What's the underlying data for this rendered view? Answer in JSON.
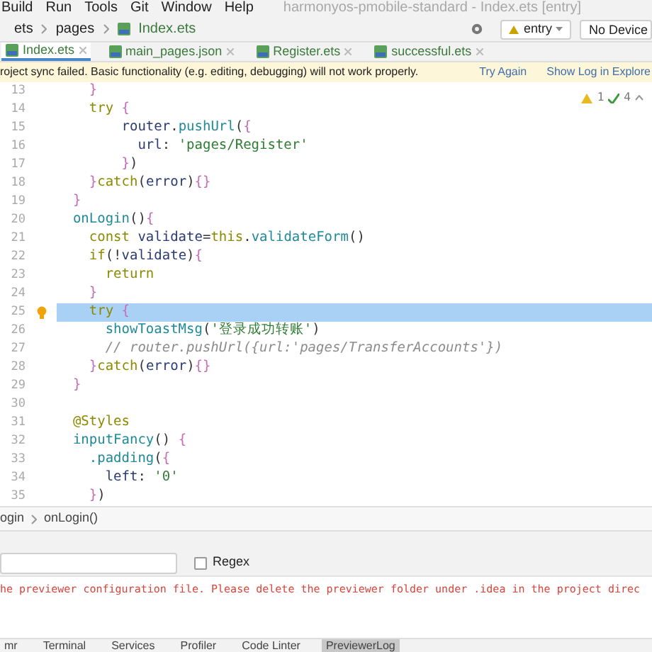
{
  "menu": [
    "Build",
    "Run",
    "Tools",
    "Git",
    "Window",
    "Help"
  ],
  "window_title": "harmonyos-pmobile-standard - Index.ets [entry]",
  "breadcrumb": [
    "ets",
    "pages",
    "Index.ets"
  ],
  "run_config": {
    "module": "entry",
    "device": "No Device"
  },
  "tabs": [
    {
      "label": "Index.ets",
      "selected": true
    },
    {
      "label": "main_pages.json",
      "selected": false
    },
    {
      "label": "Register.ets",
      "selected": false
    },
    {
      "label": "successful.ets",
      "selected": false
    }
  ],
  "banner": {
    "message": "roject sync failed. Basic functionality (e.g. editing, debugging) will not work properly.",
    "actions": [
      "Try Again",
      "Show Log in Explore"
    ]
  },
  "inspections": {
    "warnings": "1",
    "weak_warnings": "4"
  },
  "code": [
    {
      "number": "13",
      "selected": false,
      "tokens": [
        {
          "kind": "brace",
          "text": "    }"
        }
      ]
    },
    {
      "number": "14",
      "selected": false,
      "tokens": [
        {
          "kind": "keyword",
          "text": "    try"
        },
        {
          "kind": "brace",
          "text": " {"
        }
      ]
    },
    {
      "number": "15",
      "selected": false,
      "tokens": [
        {
          "kind": "ident",
          "text": "        router"
        },
        {
          "kind": "plain",
          "text": "."
        },
        {
          "kind": "func",
          "text": "pushUrl"
        },
        {
          "kind": "plain",
          "text": "("
        },
        {
          "kind": "brace",
          "text": "{"
        }
      ]
    },
    {
      "number": "16",
      "selected": false,
      "tokens": [
        {
          "kind": "prop",
          "text": "          url"
        },
        {
          "kind": "plain",
          "text": ": "
        },
        {
          "kind": "string",
          "text": "'pages/Register'"
        }
      ]
    },
    {
      "number": "17",
      "selected": false,
      "tokens": [
        {
          "kind": "brace",
          "text": "        }"
        },
        {
          "kind": "plain",
          "text": ")"
        }
      ]
    },
    {
      "number": "18",
      "selected": false,
      "tokens": [
        {
          "kind": "brace",
          "text": "    }"
        },
        {
          "kind": "keyword",
          "text": "catch"
        },
        {
          "kind": "plain",
          "text": "("
        },
        {
          "kind": "ident",
          "text": "error"
        },
        {
          "kind": "plain",
          "text": ")"
        },
        {
          "kind": "brace",
          "text": "{}"
        }
      ]
    },
    {
      "number": "19",
      "selected": false,
      "tokens": [
        {
          "kind": "brace",
          "text": "  }"
        }
      ]
    },
    {
      "number": "20",
      "selected": false,
      "tokens": [
        {
          "kind": "func",
          "text": "  onLogin"
        },
        {
          "kind": "plain",
          "text": "()"
        },
        {
          "kind": "brace",
          "text": "{"
        }
      ]
    },
    {
      "number": "21",
      "selected": false,
      "tokens": [
        {
          "kind": "keyword",
          "text": "    const"
        },
        {
          "kind": "ident",
          "text": " validate"
        },
        {
          "kind": "plain",
          "text": "="
        },
        {
          "kind": "keyword",
          "text": "this"
        },
        {
          "kind": "plain",
          "text": "."
        },
        {
          "kind": "func",
          "text": "validateForm"
        },
        {
          "kind": "plain",
          "text": "()"
        }
      ]
    },
    {
      "number": "22",
      "selected": false,
      "tokens": [
        {
          "kind": "keyword",
          "text": "    if"
        },
        {
          "kind": "plain",
          "text": "(!"
        },
        {
          "kind": "ident",
          "text": "validate"
        },
        {
          "kind": "plain",
          "text": ")"
        },
        {
          "kind": "brace",
          "text": "{"
        }
      ]
    },
    {
      "number": "23",
      "selected": false,
      "tokens": [
        {
          "kind": "keyword",
          "text": "      return"
        }
      ]
    },
    {
      "number": "24",
      "selected": false,
      "tokens": [
        {
          "kind": "brace",
          "text": "    }"
        }
      ]
    },
    {
      "number": "25",
      "selected": true,
      "bulb": true,
      "tokens": [
        {
          "kind": "keyword",
          "text": "    try"
        },
        {
          "kind": "brace",
          "text": " {"
        }
      ]
    },
    {
      "number": "26",
      "selected": false,
      "tokens": [
        {
          "kind": "func",
          "text": "      showToastMsg"
        },
        {
          "kind": "plain",
          "text": "("
        },
        {
          "kind": "string",
          "text": "'登录成功转账'"
        },
        {
          "kind": "plain",
          "text": ")"
        }
      ]
    },
    {
      "number": "27",
      "selected": false,
      "tokens": [
        {
          "kind": "comment",
          "text": "      // router.pushUrl({url:'pages/TransferAccounts'})"
        }
      ]
    },
    {
      "number": "28",
      "selected": false,
      "tokens": [
        {
          "kind": "brace",
          "text": "    }"
        },
        {
          "kind": "keyword",
          "text": "catch"
        },
        {
          "kind": "plain",
          "text": "("
        },
        {
          "kind": "ident",
          "text": "error"
        },
        {
          "kind": "plain",
          "text": ")"
        },
        {
          "kind": "brace",
          "text": "{}"
        }
      ]
    },
    {
      "number": "29",
      "selected": false,
      "tokens": [
        {
          "kind": "brace",
          "text": "  }"
        }
      ]
    },
    {
      "number": "30",
      "selected": false
    },
    {
      "number": "31",
      "selected": false,
      "tokens": [
        {
          "kind": "keyword",
          "text": "  @Styles"
        }
      ]
    },
    {
      "number": "32",
      "selected": false,
      "tokens": [
        {
          "kind": "func",
          "text": "  inputFancy"
        },
        {
          "kind": "plain",
          "text": "()"
        },
        {
          "kind": "brace",
          "text": " {"
        }
      ]
    },
    {
      "number": "33",
      "selected": false,
      "tokens": [
        {
          "kind": "func",
          "text": "    .padding"
        },
        {
          "kind": "plain",
          "text": "("
        },
        {
          "kind": "brace",
          "text": "{"
        }
      ]
    },
    {
      "number": "34",
      "selected": false,
      "tokens": [
        {
          "kind": "prop",
          "text": "      left"
        },
        {
          "kind": "plain",
          "text": ": "
        },
        {
          "kind": "string",
          "text": "'0'"
        }
      ]
    },
    {
      "number": "35",
      "selected": false,
      "tokens": [
        {
          "kind": "brace",
          "text": "    }"
        },
        {
          "kind": "plain",
          "text": ")"
        }
      ]
    }
  ],
  "code_breadcrumb": [
    "ogin",
    "onLogin()"
  ],
  "search": {
    "regex": {
      "label": "Regex",
      "checked": false
    }
  },
  "log": "he previewer configuration file. Please delete the previewer folder under .idea in the project direc",
  "tool_tabs": [
    {
      "label": "mr",
      "selected": false
    },
    {
      "label": "Terminal",
      "selected": false
    },
    {
      "label": "Services",
      "selected": false
    },
    {
      "label": "Profiler",
      "selected": false
    },
    {
      "label": "Code Linter",
      "selected": false
    },
    {
      "label": "PreviewerLog",
      "selected": true
    }
  ]
}
